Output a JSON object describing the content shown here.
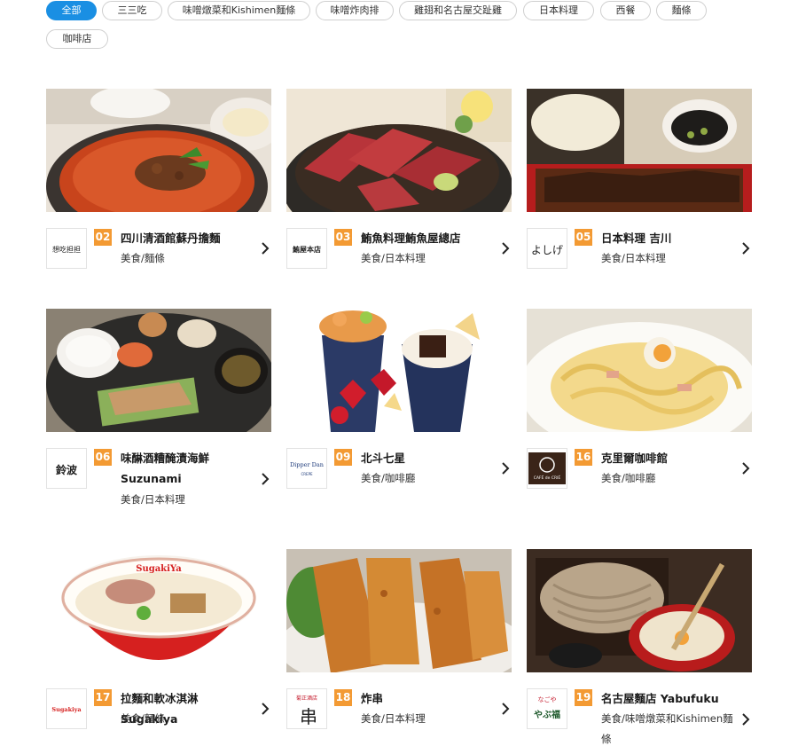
{
  "filters": [
    {
      "label": "全部",
      "active": true
    },
    {
      "label": "三三吃"
    },
    {
      "label": "味噌燉菜和Kishimen麵條"
    },
    {
      "label": "味噌炸肉排"
    },
    {
      "label": "雞翅和名古屋交趾雞"
    },
    {
      "label": "日本料理"
    },
    {
      "label": "西餐"
    },
    {
      "label": "麵條"
    },
    {
      "label": "咖啡店"
    }
  ],
  "stores": [
    {
      "num": "02",
      "name": "四川清酒館蘇丹擔麵",
      "category": "美食/麵條",
      "logo_text": "想吃担担",
      "photo": "tantanmen-bowl"
    },
    {
      "num": "03",
      "name": "鮪魚料理鮪魚屋總店",
      "category": "美食/日本料理",
      "logo_text": "鮪屋本店",
      "photo": "tuna-rice-bowl"
    },
    {
      "num": "05",
      "name": "日本料理 吉川",
      "category": "美食/日本料理",
      "logo_text": "よしげ",
      "photo": "miso-katsu-set"
    },
    {
      "num": "06",
      "name": "味醂酒糟醃漬海鮮 Suzunami",
      "category": "美食/日本料理",
      "logo_text": "鈴波",
      "photo": "grilled-fish-set"
    },
    {
      "num": "09",
      "name": "北斗七星",
      "category": "美食/咖啡廳",
      "logo_text": "Dipper Dan",
      "logo_sub": "CREPE",
      "photo": "crepes"
    },
    {
      "num": "16",
      "name": "克里爾咖啡館",
      "category": "美食/咖啡廳",
      "logo_text": "CAFÉ de CRIÉ",
      "photo": "carbonara-pasta"
    },
    {
      "num": "17",
      "name": "拉麵和軟冰淇淋 Sugakiya",
      "category": "美食/麵條",
      "logo_text": "Sugakiya",
      "photo": "ramen-bowl"
    },
    {
      "num": "18",
      "name": "炸串",
      "category": "美食/日本料理",
      "logo_text": "串",
      "logo_sub": "菊正酒店",
      "photo": "kushikatsu"
    },
    {
      "num": "19",
      "name": "名古屋麵店 Yabufuku",
      "category": "美食/味噌燉菜和Kishimen麵條",
      "logo_text": "やぶ福",
      "logo_sub": "なごや",
      "photo": "soba-noodles"
    }
  ],
  "colors": {
    "accent": "#1a8fe3",
    "badge": "#f39a33"
  },
  "icons": {
    "more": "chevron-right-icon"
  }
}
